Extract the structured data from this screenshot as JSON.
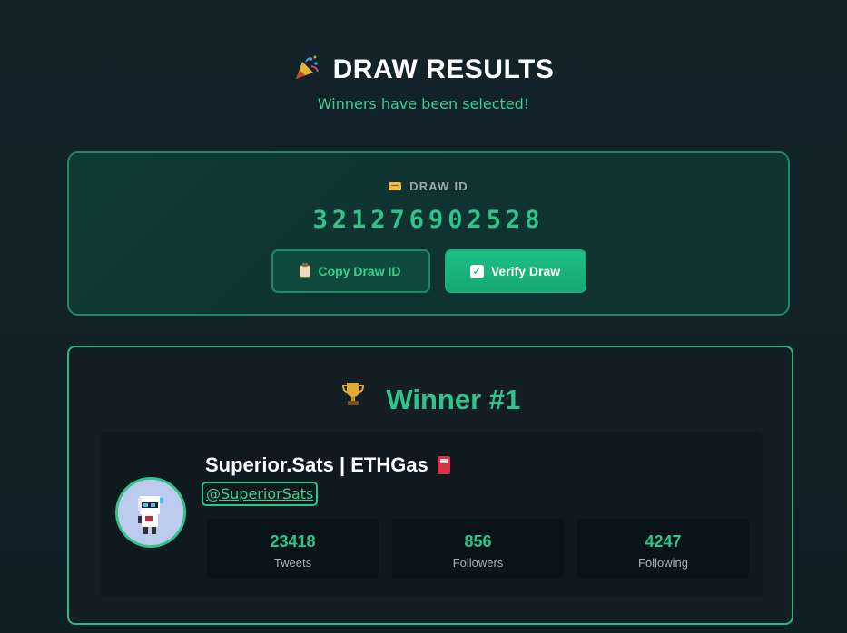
{
  "header": {
    "title": "DRAW RESULTS",
    "subtitle": "Winners have been selected!"
  },
  "draw": {
    "label": "DRAW ID",
    "id": "321276902528",
    "copy_label": "Copy Draw ID",
    "verify_label": "Verify Draw"
  },
  "winner": {
    "title": "Winner #1",
    "display_name": "Superior.Sats | ETHGas",
    "handle": "@SuperiorSats",
    "stats": [
      {
        "value": "23418",
        "label": "Tweets"
      },
      {
        "value": "856",
        "label": "Followers"
      },
      {
        "value": "4247",
        "label": "Following"
      }
    ]
  },
  "icons": {
    "title": "party-popper-icon",
    "draw_label": "ticket-icon",
    "copy": "clipboard-icon",
    "verify": "check-box-icon",
    "winner": "trophy-icon",
    "name": "fuel-pump-icon"
  },
  "colors": {
    "accent": "#2ec48a",
    "background": "#13232a",
    "draw_card": "#0f3a34",
    "winner_card": "#151f23",
    "stat_box": "#0a1418"
  }
}
